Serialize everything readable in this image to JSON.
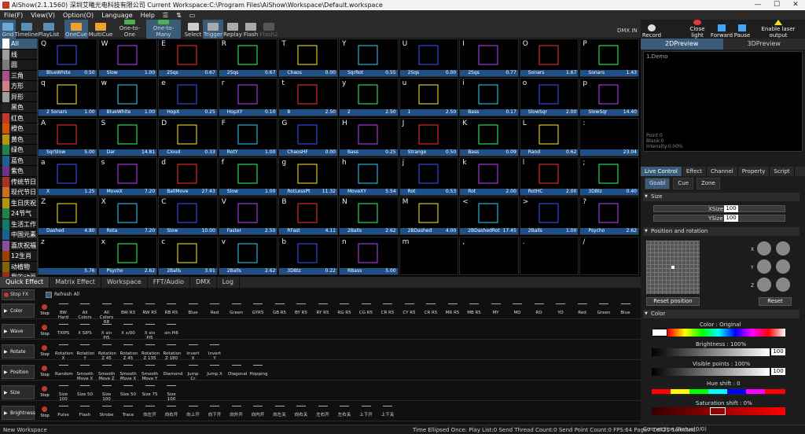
{
  "titlebar": {
    "text": "AiShow(2.1.1560) 深圳艾曦光电科技有限公司 Current Workspace:C:\\Program Files\\AiShow\\Workspace\\Default.workspace"
  },
  "menu": [
    "File(F)",
    "View(V)",
    "Option(O)",
    "Language",
    "Help"
  ],
  "toolbar": [
    "Grid",
    "Timeline",
    "PlayList",
    "OneCue",
    "MultiCue",
    "One-to-One",
    "One-to-Many",
    "Select",
    "Trigger",
    "Replay",
    "Flash",
    "Flash2"
  ],
  "dmx_in": "DMX IN",
  "right_toolbar": [
    "Record",
    "Close light",
    "Forward",
    "Pause",
    "Enable laser output"
  ],
  "categories": [
    {
      "label": "All",
      "color": "#ffffff"
    },
    {
      "label": "线",
      "color": "#9e9e9e"
    },
    {
      "label": "圆",
      "color": "#7b7b7b"
    },
    {
      "label": "三角",
      "color": "#a8508b"
    },
    {
      "label": "方形",
      "color": "#d08080"
    },
    {
      "label": "异形",
      "color": "#9e9e9e"
    },
    {
      "label": "黑色",
      "color": "#222222"
    },
    {
      "label": "红色",
      "color": "#c0392b"
    },
    {
      "label": "橙色",
      "color": "#d35400"
    },
    {
      "label": "黄色",
      "color": "#b7950b"
    },
    {
      "label": "绿色",
      "color": "#1e8449"
    },
    {
      "label": "蓝色",
      "color": "#1f618d"
    },
    {
      "label": "紫色",
      "color": "#6c3483"
    },
    {
      "label": "传统节日",
      "color": "#a93226"
    },
    {
      "label": "现代节日",
      "color": "#ca6f1e"
    },
    {
      "label": "生日庆祝",
      "color": "#b7950b"
    },
    {
      "label": "24节气",
      "color": "#1e8449"
    },
    {
      "label": "生活工作",
      "color": "#117a65"
    },
    {
      "label": "中国元素",
      "color": "#1f618d"
    },
    {
      "label": "喜庆祝福",
      "color": "#884ea0"
    },
    {
      "label": "12生肖",
      "color": "#a04000"
    },
    {
      "label": "动植物",
      "color": "#7d6608"
    },
    {
      "label": "我的动画",
      "color": "#943126"
    }
  ],
  "cells": [
    [
      {
        "k": "Q",
        "n": "BlueWhite",
        "v": "0.50"
      },
      {
        "k": "W",
        "n": "Slow",
        "v": "1.00"
      },
      {
        "k": "E",
        "n": "2Sqs",
        "v": "0.67"
      },
      {
        "k": "R",
        "n": "2Sqs",
        "v": "0.67"
      },
      {
        "k": "T",
        "n": "Chaos",
        "v": "0.00"
      },
      {
        "k": "Y",
        "n": "SqrRot",
        "v": "0.55"
      },
      {
        "k": "U",
        "n": "2Sqs",
        "v": "0.00"
      },
      {
        "k": "I",
        "n": "2Sqs",
        "v": "0.77"
      },
      {
        "k": "O",
        "n": "Sonars",
        "v": "1.67"
      },
      {
        "k": "P",
        "n": "Sonars",
        "v": "1.43"
      }
    ],
    [
      {
        "k": "q",
        "n": "2 Sonars",
        "v": "1.00"
      },
      {
        "k": "w",
        "n": "BlueWhite",
        "v": "1.00"
      },
      {
        "k": "e",
        "n": "HopX",
        "v": "0.25"
      },
      {
        "k": "r",
        "n": "HopXY",
        "v": "0.10"
      },
      {
        "k": "t",
        "n": "8",
        "v": "2.50"
      },
      {
        "k": "y",
        "n": "2",
        "v": "2.50"
      },
      {
        "k": "u",
        "n": "1",
        "v": "2.50"
      },
      {
        "k": "i",
        "n": "Bass",
        "v": "0.17"
      },
      {
        "k": "o",
        "n": "SlowSqr",
        "v": "2.00"
      },
      {
        "k": "p",
        "n": "SlowSqr",
        "v": "14.40"
      }
    ],
    [
      {
        "k": "A",
        "n": "SqrSlow",
        "v": "5.00"
      },
      {
        "k": "S",
        "n": "Dar",
        "v": "14.81"
      },
      {
        "k": "D",
        "n": "Cloud",
        "v": "0.33"
      },
      {
        "k": "F",
        "n": "RotY",
        "v": "1.00"
      },
      {
        "k": "G",
        "n": "ChaosHF",
        "v": "0.00"
      },
      {
        "k": "H",
        "n": "Bass",
        "v": "0.25"
      },
      {
        "k": "J",
        "n": "Strange",
        "v": "0.50"
      },
      {
        "k": "K",
        "n": "Bass",
        "v": "0.09"
      },
      {
        "k": "L",
        "n": "Rand",
        "v": "0.62"
      },
      {
        "k": ":",
        "n": "",
        "v": "23.04"
      }
    ],
    [
      {
        "k": "a",
        "n": "X",
        "v": "1.25"
      },
      {
        "k": "s",
        "n": "MoveX",
        "v": "7.20"
      },
      {
        "k": "d",
        "n": "BallMove",
        "v": "27.43"
      },
      {
        "k": "f",
        "n": "Slow",
        "v": "1.00"
      },
      {
        "k": "g",
        "n": "RotLessPt",
        "v": "11.32"
      },
      {
        "k": "h",
        "n": "MoveXY",
        "v": "5.54"
      },
      {
        "k": "j",
        "n": "Rot",
        "v": "0.53"
      },
      {
        "k": "k",
        "n": "Rot",
        "v": "2.00"
      },
      {
        "k": "l",
        "n": "RotHC",
        "v": "2.00"
      },
      {
        "k": ";",
        "n": "3DBlz",
        "v": "0.40"
      }
    ],
    [
      {
        "k": "Z",
        "n": "Dashed",
        "v": "4.80"
      },
      {
        "k": "X",
        "n": "Rota",
        "v": "7.20"
      },
      {
        "k": "C",
        "n": "Slow",
        "v": "10.00"
      },
      {
        "k": "V",
        "n": "Faster",
        "v": "2.50"
      },
      {
        "k": "B",
        "n": "RFast",
        "v": "4.11"
      },
      {
        "k": "N",
        "n": "2Balls",
        "v": "2.62"
      },
      {
        "k": "M",
        "n": "2BDashed",
        "v": "4.00"
      },
      {
        "k": "<",
        "n": "2BDashedRot",
        "v": "17.45"
      },
      {
        "k": ">",
        "n": "2Balls",
        "v": "1.00"
      },
      {
        "k": "?",
        "n": "Psycho",
        "v": "2.62"
      }
    ],
    [
      {
        "k": "z",
        "n": "",
        "v": "5.76"
      },
      {
        "k": "x",
        "n": "Psycho",
        "v": "2.62"
      },
      {
        "k": "c",
        "n": "2Balls",
        "v": "3.91"
      },
      {
        "k": "v",
        "n": "2Balls",
        "v": "2.62"
      },
      {
        "k": "b",
        "n": "3DBlz",
        "v": "0.22"
      },
      {
        "k": "n",
        "n": "RBass",
        "v": "5.00"
      },
      {
        "k": "m",
        "n": "",
        "v": ""
      },
      {
        "k": ",",
        "n": "",
        "v": ""
      },
      {
        "k": ".",
        "n": "",
        "v": ""
      },
      {
        "k": "/",
        "n": "",
        "v": ""
      }
    ]
  ],
  "bottom_tabs": [
    "Quick Effect",
    "Matrix Effect",
    "Workspace",
    "FFT/Audio",
    "DMX",
    "Log"
  ],
  "quick_effect": {
    "stop_fx": "Stop FX",
    "refresh_all": "Refresh All",
    "stop": "Stop",
    "rows": [
      {
        "label": "Color",
        "effects": [
          "BW Hard",
          "All Colors",
          "All Colors R8",
          "BW R3",
          "RW R5",
          "RB R5",
          "Blue",
          "Red",
          "Green",
          "GYR5",
          "GB R5",
          "BY R5",
          "RY R5",
          "RG R5",
          "CG R5",
          "CR R5",
          "CY R5",
          "CR R5",
          "MR R5",
          "MB R5",
          "MY",
          "MD",
          "RO",
          "YO",
          "Red",
          "Green",
          "Blue"
        ]
      },
      {
        "label": "Wave",
        "effects": [
          "TXIPS",
          "X SIPS",
          "X sin Pi5",
          "X x/00",
          "X sin Pi5",
          "sin Pi6"
        ]
      },
      {
        "label": "Rotate",
        "effects": [
          "Rotation X",
          "Rotation Y",
          "Rotation Z 45",
          "Rotation Z 45",
          "Rotation Z 135",
          "Rotation Z 180",
          "Invert X",
          "Invert Y"
        ]
      },
      {
        "label": "Position",
        "effects": [
          "Random",
          "Smooth Move X",
          "Smooth Move Z",
          "Smooth Move X",
          "Smooth Move Y",
          "Diamond",
          "Jump Cr",
          "Jump X",
          "Diagonal",
          "Hopping"
        ]
      },
      {
        "label": "Size",
        "effects": [
          "Size 100",
          "Size 50",
          "Size 100",
          "Size 50",
          "Size 75",
          "Size 100"
        ]
      },
      {
        "label": "Brightness",
        "effects": [
          "Pulse",
          "Flash",
          "Strobe",
          "Trace",
          "向左开",
          "向右开",
          "向上开",
          "向下开",
          "向外开",
          "向内开",
          "向左关",
          "向右关",
          "左右开",
          "左右关",
          "上下开",
          "上下关"
        ]
      }
    ]
  },
  "preview": {
    "tabs": [
      "2DPreview",
      "3DPreview"
    ],
    "name": "1.Demo",
    "stats": [
      "Point:0",
      "Blank:0",
      "Intensity:0.00%"
    ]
  },
  "live_control": {
    "tabs": [
      "Live Control",
      "Effect",
      "Channel",
      "Property",
      "Script"
    ],
    "sub_tabs": [
      "Goabl",
      "Cue",
      "Zone"
    ],
    "size_title": "Size",
    "xsize_label": "XSize",
    "xsize_value": "100",
    "ysize_label": "YSize",
    "ysize_value": "100",
    "position_title": "Position and rotation",
    "reset_position": "Reset position",
    "reset": "Reset",
    "color_title": "Color",
    "color_label": "Color : Original",
    "brightness_label": "Brightness : 100%",
    "brightness_value": "100",
    "visible_label": "Visible points : 100%",
    "visible_value": "100",
    "hue_label": "Hue shift : 0",
    "saturation_label": "Saturation shift : 0%"
  },
  "status": {
    "workspace": "New Workspace",
    "info": "Time Ellipsed Once: Play List:0 Send Thread Count:0 Send Point Count:0 FPS:64  Page7 Cell21 Selected!",
    "connection": "Connection Status(0/0)"
  }
}
